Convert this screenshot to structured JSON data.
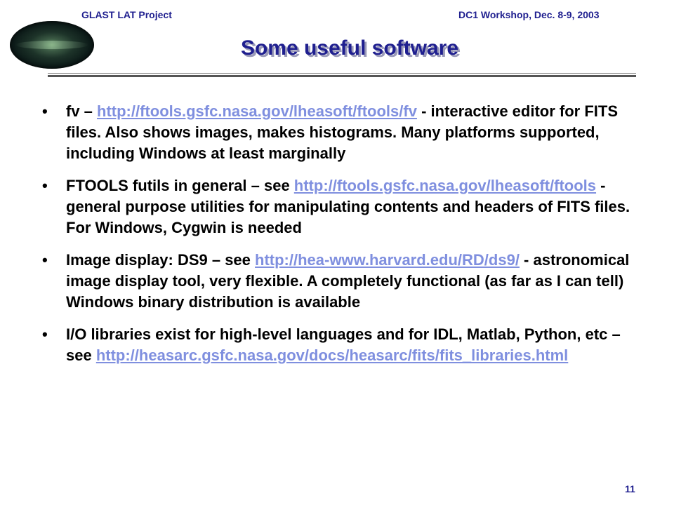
{
  "header": {
    "left": "GLAST LAT Project",
    "right": "DC1 Workshop, Dec. 8-9, 2003"
  },
  "title": "Some useful software",
  "bullets": [
    {
      "pre": "fv – ",
      "link": "http://ftools.gsfc.nasa.gov/lheasoft/ftools/fv",
      "post": " - interactive editor for FITS files.  Also shows images, makes histograms.  Many platforms supported, including Windows at least marginally"
    },
    {
      "pre": "FTOOLS futils in general – see ",
      "link": "http://ftools.gsfc.nasa.gov/lheasoft/ftools",
      "post": " - general purpose utilities for manipulating contents and headers of FITS files.  For Windows, Cygwin is needed"
    },
    {
      "pre": "Image display:  DS9 – see ",
      "link": "http://hea-www.harvard.edu/RD/ds9/",
      "post": " - astronomical image display tool, very flexible.  A completely functional (as far as I can tell) Windows binary distribution is available"
    },
    {
      "pre": "I/O libraries exist for high-level languages and for IDL, Matlab, Python, etc – see ",
      "link": "http://heasarc.gsfc.nasa.gov/docs/heasarc/fits/fits_libraries.html",
      "post": ""
    }
  ],
  "bullet_char": "•",
  "page_number": "11",
  "colors": {
    "header": "#1f1f8f",
    "link": "#7f8fdf"
  }
}
